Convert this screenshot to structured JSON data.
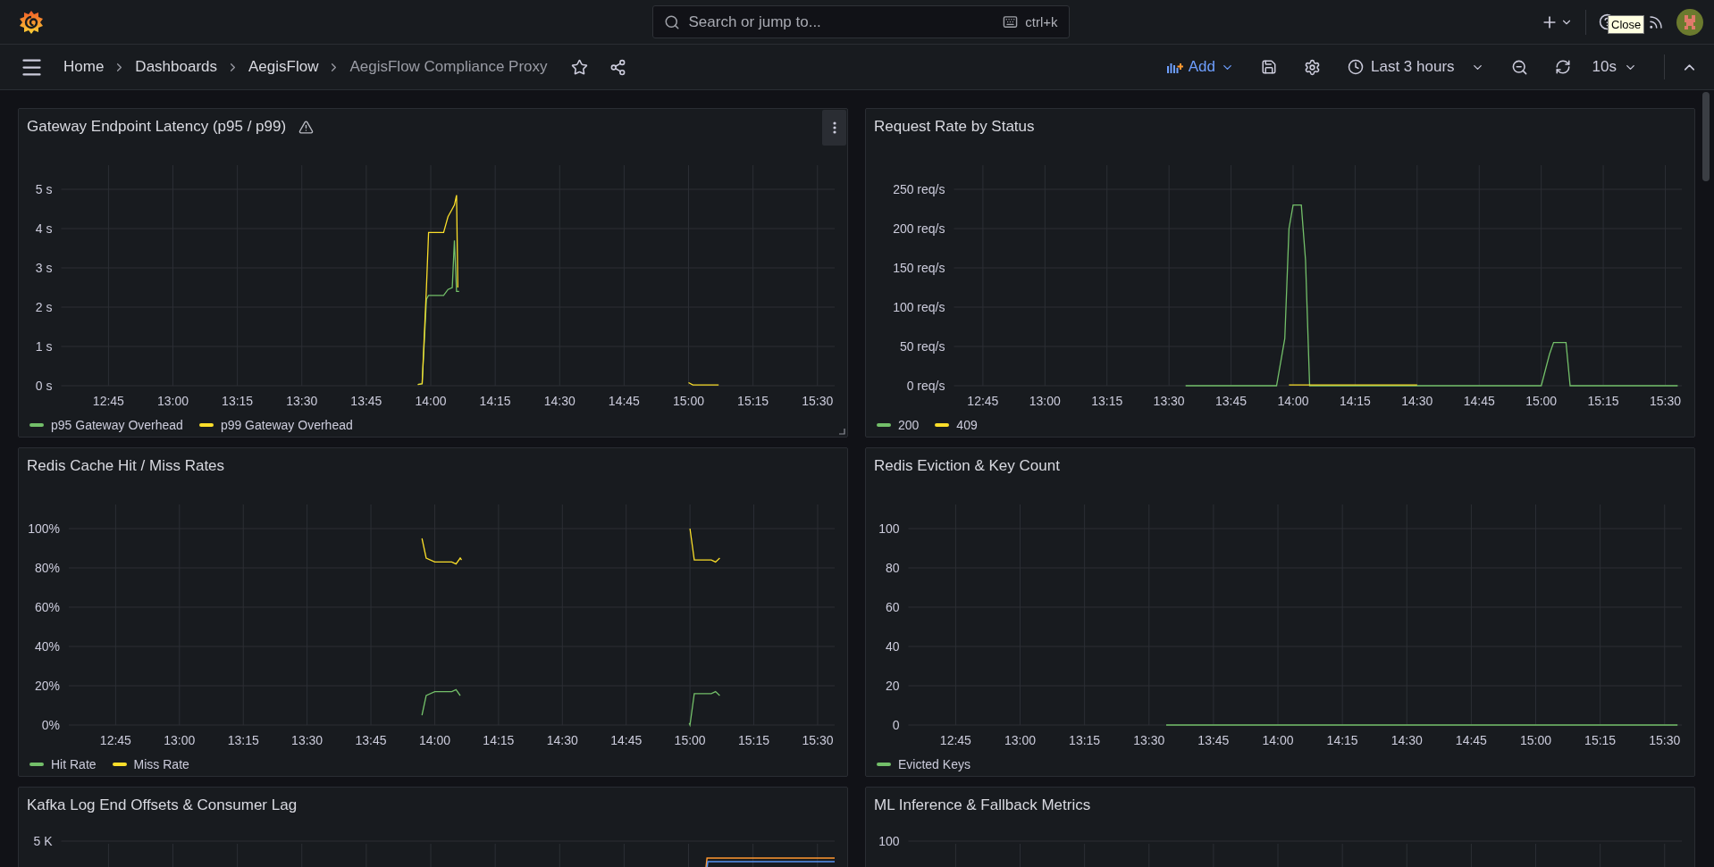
{
  "top_bar": {
    "search": {
      "placeholder": "Search or jump to...",
      "shortcut": "ctrl+k"
    },
    "tooltip": "Close"
  },
  "breadcrumbs": [
    {
      "label": "Home",
      "current": false
    },
    {
      "label": "Dashboards",
      "current": false
    },
    {
      "label": "AegisFlow",
      "current": false
    },
    {
      "label": "AegisFlow Compliance Proxy",
      "current": true
    }
  ],
  "toolbar": {
    "add_label": "Add",
    "time_range": "Last 3 hours",
    "refresh_interval": "10s"
  },
  "panels": [
    {
      "title": "Gateway Endpoint Latency (p95 / p99)",
      "warning": true,
      "hovered": true,
      "chart_data": {
        "type": "line",
        "grid": true,
        "x": [
          837,
          838,
          839,
          839.5,
          840,
          843,
          844,
          845,
          845.5,
          846,
          846.3,
          846.6,
          900,
          901,
          907
        ],
        "xlim": [
          754,
          934
        ],
        "ylim": [
          0,
          5
        ],
        "xticks": [
          {
            "value": 765,
            "label": "12:45"
          },
          {
            "value": 780,
            "label": "13:00"
          },
          {
            "value": 795,
            "label": "13:15"
          },
          {
            "value": 810,
            "label": "13:30"
          },
          {
            "value": 825,
            "label": "13:45"
          },
          {
            "value": 840,
            "label": "14:00"
          },
          {
            "value": 855,
            "label": "14:15"
          },
          {
            "value": 870,
            "label": "14:30"
          },
          {
            "value": 885,
            "label": "14:45"
          },
          {
            "value": 900,
            "label": "15:00"
          },
          {
            "value": 915,
            "label": "15:15"
          },
          {
            "value": 930,
            "label": "15:30"
          }
        ],
        "yticks": [
          {
            "value": 0,
            "label": "0 s"
          },
          {
            "value": 1,
            "label": "1 s"
          },
          {
            "value": 2,
            "label": "2 s"
          },
          {
            "value": 3,
            "label": "3 s"
          },
          {
            "value": 4,
            "label": "4 s"
          },
          {
            "value": 5,
            "label": "5 s"
          }
        ],
        "series": [
          {
            "name": "p95 Gateway Overhead",
            "color": "#73bf69",
            "values": [
              0.03,
              0.05,
              2.2,
              2.3,
              2.3,
              2.3,
              2.45,
              2.5,
              3.7,
              2.4,
              2.4,
              2.4,
              null,
              null,
              null
            ]
          },
          {
            "name": "p99 Gateway Overhead",
            "color": "#fade2a",
            "values": [
              0.03,
              0.05,
              2.5,
              3.9,
              3.9,
              3.9,
              4.3,
              4.5,
              4.6,
              4.85,
              2.5,
              null,
              0.08,
              0.02,
              0.02
            ]
          }
        ]
      }
    },
    {
      "title": "Request Rate by Status",
      "warning": false,
      "hovered": false,
      "chart_data": {
        "type": "line",
        "grid": true,
        "x": [
          814,
          836,
          838,
          839,
          840,
          842,
          843,
          844,
          870,
          900,
          902,
          903,
          906,
          907,
          933
        ],
        "xlim": [
          758,
          934
        ],
        "ylim": [
          0,
          250
        ],
        "xticks": [
          {
            "value": 765,
            "label": "12:45"
          },
          {
            "value": 780,
            "label": "13:00"
          },
          {
            "value": 795,
            "label": "13:15"
          },
          {
            "value": 810,
            "label": "13:30"
          },
          {
            "value": 825,
            "label": "13:45"
          },
          {
            "value": 840,
            "label": "14:00"
          },
          {
            "value": 855,
            "label": "14:15"
          },
          {
            "value": 870,
            "label": "14:30"
          },
          {
            "value": 885,
            "label": "14:45"
          },
          {
            "value": 900,
            "label": "15:00"
          },
          {
            "value": 915,
            "label": "15:15"
          },
          {
            "value": 930,
            "label": "15:30"
          }
        ],
        "yticks": [
          {
            "value": 0,
            "label": "0 req/s"
          },
          {
            "value": 50,
            "label": "50 req/s"
          },
          {
            "value": 100,
            "label": "100 req/s"
          },
          {
            "value": 150,
            "label": "150 req/s"
          },
          {
            "value": 200,
            "label": "200 req/s"
          },
          {
            "value": 250,
            "label": "250 req/s"
          }
        ],
        "series": [
          {
            "name": "200",
            "color": "#73bf69",
            "values": [
              0,
              0,
              60,
              200,
              230,
              230,
              160,
              0,
              0,
              0,
              40,
              55,
              55,
              0,
              0
            ]
          },
          {
            "name": "409",
            "color": "#fade2a",
            "values": [
              null,
              null,
              null,
              1,
              1,
              1,
              1,
              1,
              1,
              null,
              null,
              null,
              null,
              null,
              null
            ]
          }
        ]
      }
    },
    {
      "title": "Redis Cache Hit / Miss Rates",
      "warning": false,
      "hovered": false,
      "chart_data": {
        "type": "line",
        "grid": true,
        "x": [
          837,
          838,
          840,
          844,
          845,
          846,
          846.3,
          899.8,
          900,
          901,
          905,
          906,
          907
        ],
        "xlim": [
          754,
          934
        ],
        "ylim": [
          0,
          100
        ],
        "xticks": [
          {
            "value": 765,
            "label": "12:45"
          },
          {
            "value": 780,
            "label": "13:00"
          },
          {
            "value": 795,
            "label": "13:15"
          },
          {
            "value": 810,
            "label": "13:30"
          },
          {
            "value": 825,
            "label": "13:45"
          },
          {
            "value": 840,
            "label": "14:00"
          },
          {
            "value": 855,
            "label": "14:15"
          },
          {
            "value": 870,
            "label": "14:30"
          },
          {
            "value": 885,
            "label": "14:45"
          },
          {
            "value": 900,
            "label": "15:00"
          },
          {
            "value": 915,
            "label": "15:15"
          },
          {
            "value": 930,
            "label": "15:30"
          }
        ],
        "yticks": [
          {
            "value": 0,
            "label": "0%"
          },
          {
            "value": 20,
            "label": "20%"
          },
          {
            "value": 40,
            "label": "40%"
          },
          {
            "value": 60,
            "label": "60%"
          },
          {
            "value": 80,
            "label": "80%"
          },
          {
            "value": 100,
            "label": "100%"
          }
        ],
        "series": [
          {
            "name": "Hit Rate",
            "color": "#73bf69",
            "values": [
              5,
              15,
              17,
              17,
              18,
              15,
              null,
              1,
              0,
              16,
              16,
              17,
              15
            ]
          },
          {
            "name": "Miss Rate",
            "color": "#fade2a",
            "values": [
              95,
              85,
              83,
              83,
              82,
              85,
              84,
              null,
              100,
              84,
              84,
              83,
              85
            ]
          }
        ]
      }
    },
    {
      "title": "Redis Eviction & Key Count",
      "warning": false,
      "hovered": false,
      "chart_data": {
        "type": "line",
        "grid": true,
        "x": [
          814,
          933
        ],
        "xlim": [
          754,
          934
        ],
        "ylim": [
          0,
          100
        ],
        "xticks": [
          {
            "value": 765,
            "label": "12:45"
          },
          {
            "value": 780,
            "label": "13:00"
          },
          {
            "value": 795,
            "label": "13:15"
          },
          {
            "value": 810,
            "label": "13:30"
          },
          {
            "value": 825,
            "label": "13:45"
          },
          {
            "value": 840,
            "label": "14:00"
          },
          {
            "value": 855,
            "label": "14:15"
          },
          {
            "value": 870,
            "label": "14:30"
          },
          {
            "value": 885,
            "label": "14:45"
          },
          {
            "value": 900,
            "label": "15:00"
          },
          {
            "value": 915,
            "label": "15:15"
          },
          {
            "value": 930,
            "label": "15:30"
          }
        ],
        "yticks": [
          0,
          20,
          40,
          60,
          80,
          100
        ],
        "series": [
          {
            "name": "Evicted Keys",
            "color": "#73bf69",
            "values": [
              0,
              0
            ]
          }
        ]
      }
    },
    {
      "title": "Kafka Log End Offsets & Consumer Lag",
      "warning": false,
      "hovered": false,
      "kind": "cut_chart",
      "axis_label": "5 K",
      "traces": true
    },
    {
      "title": "ML Inference & Fallback Metrics",
      "warning": false,
      "hovered": false,
      "kind": "cut_chart",
      "axis_label": "100",
      "traces": false
    }
  ]
}
